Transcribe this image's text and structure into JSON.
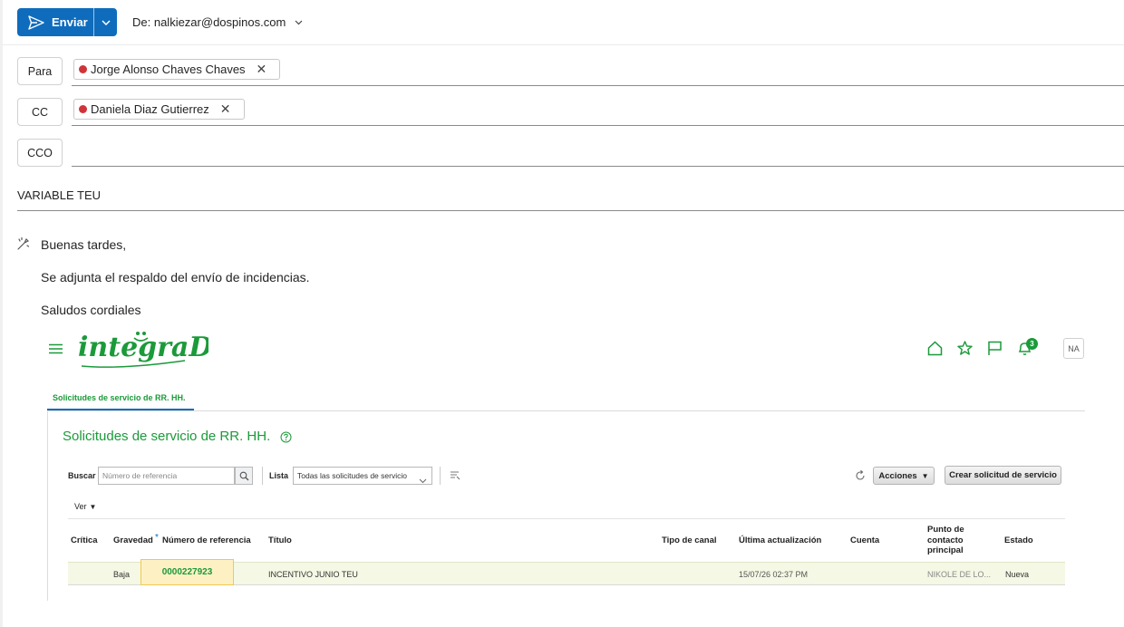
{
  "toolbar": {
    "send_label": "Enviar",
    "from_label": "De: nalkiezar@dospinos.com"
  },
  "recipients": {
    "to_label": "Para",
    "to_chip": "Jorge Alonso Chaves Chaves",
    "cc_label": "CC",
    "cc_chip": "Daniela Diaz Gutierrez",
    "bcc_label": "CCO"
  },
  "subject": "VARIABLE TEU",
  "body": {
    "greeting": "Buenas tardes,",
    "line1": "Se adjunta el respaldo del envío de incidencias.",
    "closing": "Saludos cordiales"
  },
  "embedded": {
    "logo_text": "integraDos",
    "notification_count": "3",
    "avatar": "NA",
    "tab_label": "Solicitudes de servicio de RR. HH.",
    "page_title": "Solicitudes de servicio de RR. HH.",
    "search_label": "Buscar",
    "search_placeholder": "Número de referencia",
    "list_label": "Lista",
    "list_value": "Todas las solicitudes de servicio",
    "actions_label": "Acciones",
    "create_label": "Crear solicitud de servicio",
    "view_label": "Ver",
    "columns": {
      "critica": "Crítica",
      "gravedad": "Gravedad",
      "required": "*",
      "numero": "Número de referencia",
      "titulo": "Título",
      "canal": "Tipo de canal",
      "ultima": "Última actualización",
      "cuenta": "Cuenta",
      "punto1": "Punto de",
      "punto2": "contacto",
      "punto3": "principal",
      "estado": "Estado"
    },
    "row": {
      "gravedad": "Baja",
      "numero": "0000227923",
      "titulo": "INCENTIVO JUNIO TEU",
      "ultima": "15/07/26 02:37 PM",
      "contacto": "NIKOLE DE LO...",
      "estado": "Nueva"
    }
  },
  "colors": {
    "accent": "#0f6cbd",
    "brand_green": "#1b9a3a",
    "presence_red": "#d13438"
  }
}
